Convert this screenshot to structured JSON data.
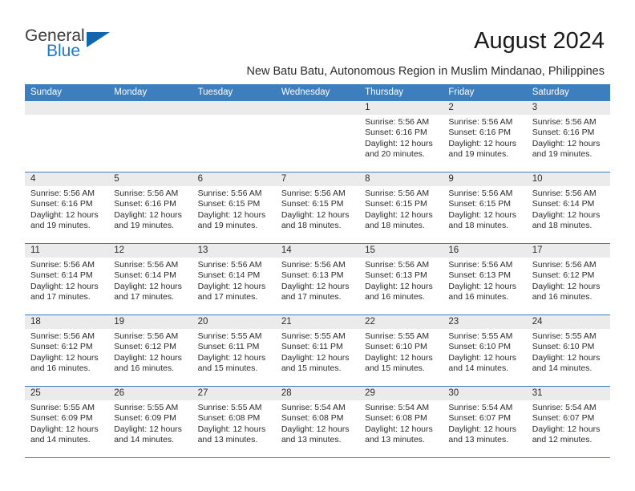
{
  "brand": {
    "name_part1": "General",
    "name_part2": "Blue",
    "triangle_color": "#1266ab",
    "blue_color": "#1b79c9"
  },
  "header": {
    "month_title": "August 2024",
    "subtitle": "New Batu Batu, Autonomous Region in Muslim Mindanao, Philippines",
    "accent_color": "#3d7ebf"
  },
  "weekdays": [
    "Sunday",
    "Monday",
    "Tuesday",
    "Wednesday",
    "Thursday",
    "Friday",
    "Saturday"
  ],
  "labels": {
    "sunrise_prefix": "Sunrise:",
    "sunset_prefix": "Sunset:",
    "daylight_prefix": "Daylight:"
  },
  "weeks": [
    [
      {
        "day": "",
        "empty": true
      },
      {
        "day": "",
        "empty": true
      },
      {
        "day": "",
        "empty": true
      },
      {
        "day": "",
        "empty": true
      },
      {
        "day": "1",
        "sunrise": "Sunrise: 5:56 AM",
        "sunset": "Sunset: 6:16 PM",
        "daylight": "Daylight: 12 hours and 20 minutes."
      },
      {
        "day": "2",
        "sunrise": "Sunrise: 5:56 AM",
        "sunset": "Sunset: 6:16 PM",
        "daylight": "Daylight: 12 hours and 19 minutes."
      },
      {
        "day": "3",
        "sunrise": "Sunrise: 5:56 AM",
        "sunset": "Sunset: 6:16 PM",
        "daylight": "Daylight: 12 hours and 19 minutes."
      }
    ],
    [
      {
        "day": "4",
        "sunrise": "Sunrise: 5:56 AM",
        "sunset": "Sunset: 6:16 PM",
        "daylight": "Daylight: 12 hours and 19 minutes."
      },
      {
        "day": "5",
        "sunrise": "Sunrise: 5:56 AM",
        "sunset": "Sunset: 6:16 PM",
        "daylight": "Daylight: 12 hours and 19 minutes."
      },
      {
        "day": "6",
        "sunrise": "Sunrise: 5:56 AM",
        "sunset": "Sunset: 6:15 PM",
        "daylight": "Daylight: 12 hours and 19 minutes."
      },
      {
        "day": "7",
        "sunrise": "Sunrise: 5:56 AM",
        "sunset": "Sunset: 6:15 PM",
        "daylight": "Daylight: 12 hours and 18 minutes."
      },
      {
        "day": "8",
        "sunrise": "Sunrise: 5:56 AM",
        "sunset": "Sunset: 6:15 PM",
        "daylight": "Daylight: 12 hours and 18 minutes."
      },
      {
        "day": "9",
        "sunrise": "Sunrise: 5:56 AM",
        "sunset": "Sunset: 6:15 PM",
        "daylight": "Daylight: 12 hours and 18 minutes."
      },
      {
        "day": "10",
        "sunrise": "Sunrise: 5:56 AM",
        "sunset": "Sunset: 6:14 PM",
        "daylight": "Daylight: 12 hours and 18 minutes."
      }
    ],
    [
      {
        "day": "11",
        "sunrise": "Sunrise: 5:56 AM",
        "sunset": "Sunset: 6:14 PM",
        "daylight": "Daylight: 12 hours and 17 minutes."
      },
      {
        "day": "12",
        "sunrise": "Sunrise: 5:56 AM",
        "sunset": "Sunset: 6:14 PM",
        "daylight": "Daylight: 12 hours and 17 minutes."
      },
      {
        "day": "13",
        "sunrise": "Sunrise: 5:56 AM",
        "sunset": "Sunset: 6:14 PM",
        "daylight": "Daylight: 12 hours and 17 minutes."
      },
      {
        "day": "14",
        "sunrise": "Sunrise: 5:56 AM",
        "sunset": "Sunset: 6:13 PM",
        "daylight": "Daylight: 12 hours and 17 minutes."
      },
      {
        "day": "15",
        "sunrise": "Sunrise: 5:56 AM",
        "sunset": "Sunset: 6:13 PM",
        "daylight": "Daylight: 12 hours and 16 minutes."
      },
      {
        "day": "16",
        "sunrise": "Sunrise: 5:56 AM",
        "sunset": "Sunset: 6:13 PM",
        "daylight": "Daylight: 12 hours and 16 minutes."
      },
      {
        "day": "17",
        "sunrise": "Sunrise: 5:56 AM",
        "sunset": "Sunset: 6:12 PM",
        "daylight": "Daylight: 12 hours and 16 minutes."
      }
    ],
    [
      {
        "day": "18",
        "sunrise": "Sunrise: 5:56 AM",
        "sunset": "Sunset: 6:12 PM",
        "daylight": "Daylight: 12 hours and 16 minutes."
      },
      {
        "day": "19",
        "sunrise": "Sunrise: 5:56 AM",
        "sunset": "Sunset: 6:12 PM",
        "daylight": "Daylight: 12 hours and 16 minutes."
      },
      {
        "day": "20",
        "sunrise": "Sunrise: 5:55 AM",
        "sunset": "Sunset: 6:11 PM",
        "daylight": "Daylight: 12 hours and 15 minutes."
      },
      {
        "day": "21",
        "sunrise": "Sunrise: 5:55 AM",
        "sunset": "Sunset: 6:11 PM",
        "daylight": "Daylight: 12 hours and 15 minutes."
      },
      {
        "day": "22",
        "sunrise": "Sunrise: 5:55 AM",
        "sunset": "Sunset: 6:10 PM",
        "daylight": "Daylight: 12 hours and 15 minutes."
      },
      {
        "day": "23",
        "sunrise": "Sunrise: 5:55 AM",
        "sunset": "Sunset: 6:10 PM",
        "daylight": "Daylight: 12 hours and 14 minutes."
      },
      {
        "day": "24",
        "sunrise": "Sunrise: 5:55 AM",
        "sunset": "Sunset: 6:10 PM",
        "daylight": "Daylight: 12 hours and 14 minutes."
      }
    ],
    [
      {
        "day": "25",
        "sunrise": "Sunrise: 5:55 AM",
        "sunset": "Sunset: 6:09 PM",
        "daylight": "Daylight: 12 hours and 14 minutes."
      },
      {
        "day": "26",
        "sunrise": "Sunrise: 5:55 AM",
        "sunset": "Sunset: 6:09 PM",
        "daylight": "Daylight: 12 hours and 14 minutes."
      },
      {
        "day": "27",
        "sunrise": "Sunrise: 5:55 AM",
        "sunset": "Sunset: 6:08 PM",
        "daylight": "Daylight: 12 hours and 13 minutes."
      },
      {
        "day": "28",
        "sunrise": "Sunrise: 5:54 AM",
        "sunset": "Sunset: 6:08 PM",
        "daylight": "Daylight: 12 hours and 13 minutes."
      },
      {
        "day": "29",
        "sunrise": "Sunrise: 5:54 AM",
        "sunset": "Sunset: 6:08 PM",
        "daylight": "Daylight: 12 hours and 13 minutes."
      },
      {
        "day": "30",
        "sunrise": "Sunrise: 5:54 AM",
        "sunset": "Sunset: 6:07 PM",
        "daylight": "Daylight: 12 hours and 13 minutes."
      },
      {
        "day": "31",
        "sunrise": "Sunrise: 5:54 AM",
        "sunset": "Sunset: 6:07 PM",
        "daylight": "Daylight: 12 hours and 12 minutes."
      }
    ]
  ]
}
